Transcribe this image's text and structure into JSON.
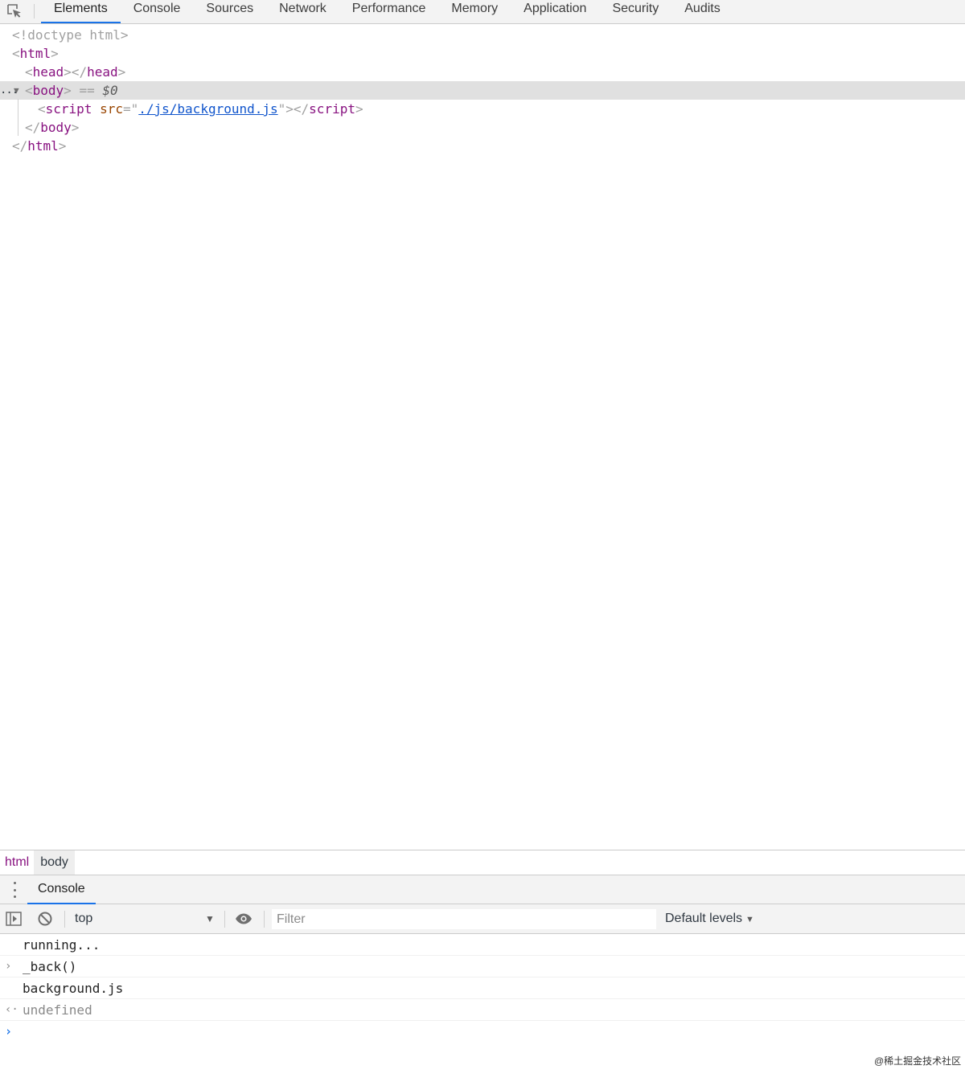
{
  "tabbar": {
    "tabs": [
      {
        "label": "Elements",
        "active": true
      },
      {
        "label": "Console",
        "active": false
      },
      {
        "label": "Sources",
        "active": false
      },
      {
        "label": "Network",
        "active": false
      },
      {
        "label": "Performance",
        "active": false
      },
      {
        "label": "Memory",
        "active": false
      },
      {
        "label": "Application",
        "active": false
      },
      {
        "label": "Security",
        "active": false
      },
      {
        "label": "Audits",
        "active": false
      }
    ],
    "inspect_icon": "inspect-element-icon"
  },
  "dom_tree": {
    "doctype": "<!doctype html>",
    "html_tag": "html",
    "head_tag": "head",
    "body_tag": "body",
    "selected_marker": "==",
    "selected_var": "$0",
    "script_tag": "script",
    "script_attr_name": "src",
    "script_attr_value": "./js/background.js",
    "ellipsis": "..."
  },
  "breadcrumb": [
    "html",
    "body"
  ],
  "drawer": {
    "tab_label": "Console",
    "menu_icon": "kebab-menu-icon"
  },
  "console_toolbar": {
    "sidebar_icon": "show-sidebar-icon",
    "clear_icon": "clear-console-icon",
    "context": "top",
    "eye_icon": "live-expression-eye-icon",
    "filter_placeholder": "Filter",
    "filter_value": "",
    "levels_label": "Default levels"
  },
  "console_messages": [
    {
      "type": "log",
      "text": "running..."
    },
    {
      "type": "input",
      "text": "_back()"
    },
    {
      "type": "log",
      "text": "background.js"
    },
    {
      "type": "result",
      "text": "undefined"
    }
  ],
  "watermark": "@稀土掘金技术社区",
  "colors": {
    "accent": "#1a73e8",
    "tag": "#881280",
    "attr_name": "#994500",
    "link": "#1155cc",
    "selected_row": "#e0e0e0",
    "toolbar_bg": "#f3f3f3"
  }
}
